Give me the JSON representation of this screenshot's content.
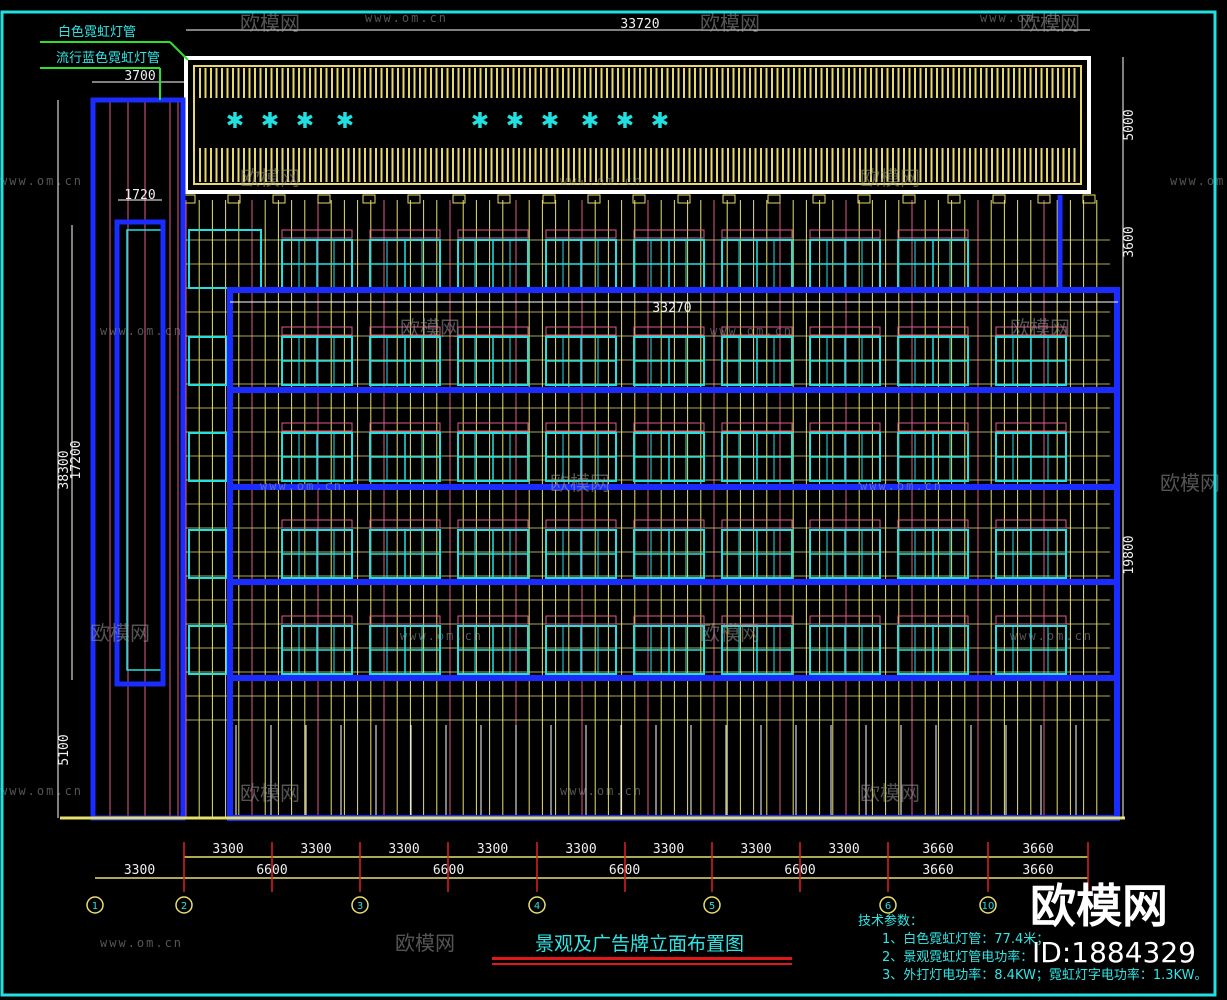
{
  "drawing": {
    "title": "景观及广告牌立面布置图",
    "labels": {
      "white_neon": "白色霓虹灯管",
      "blue_neon": "流行蓝色霓虹灯管"
    },
    "dimensions": {
      "billboard_width": "33720",
      "tower_width": "3700",
      "tower_inner_width": "1720",
      "main_width": "33270",
      "total_height": "38300",
      "tower_height": "17200",
      "ground_height": "5100",
      "billboard_height": "5000",
      "gap_height": "3600",
      "main_height": "19800"
    },
    "bay_dims_row1": [
      "3300",
      "3300",
      "3300",
      "3300",
      "3300",
      "3300",
      "3300",
      "3300",
      "3660",
      "3660"
    ],
    "bay_dims_row2": [
      "3300",
      "6600",
      "6600",
      "6600",
      "6600",
      "3660",
      "3660"
    ],
    "axes": [
      "1",
      "2",
      "3",
      "4",
      "5",
      "6",
      "10"
    ],
    "notes": {
      "heading": "技术参数：",
      "lines": [
        "1、白色霓虹灯管：77.4米；",
        "2、景观霓虹灯管电功率：",
        "3、外打灯电功率：8.4KW；霓虹灯字电功率：1.3KW。"
      ]
    },
    "colors": {
      "frame": "#1a2cff",
      "window": "#22e0e0",
      "grid": "#e6e070",
      "neon": "#e6d86a",
      "axis": "#e02020",
      "border": "#22e0e0"
    }
  },
  "watermark": {
    "brand": "欧模网",
    "url": "www.om.cn",
    "id": "ID:1884329"
  }
}
